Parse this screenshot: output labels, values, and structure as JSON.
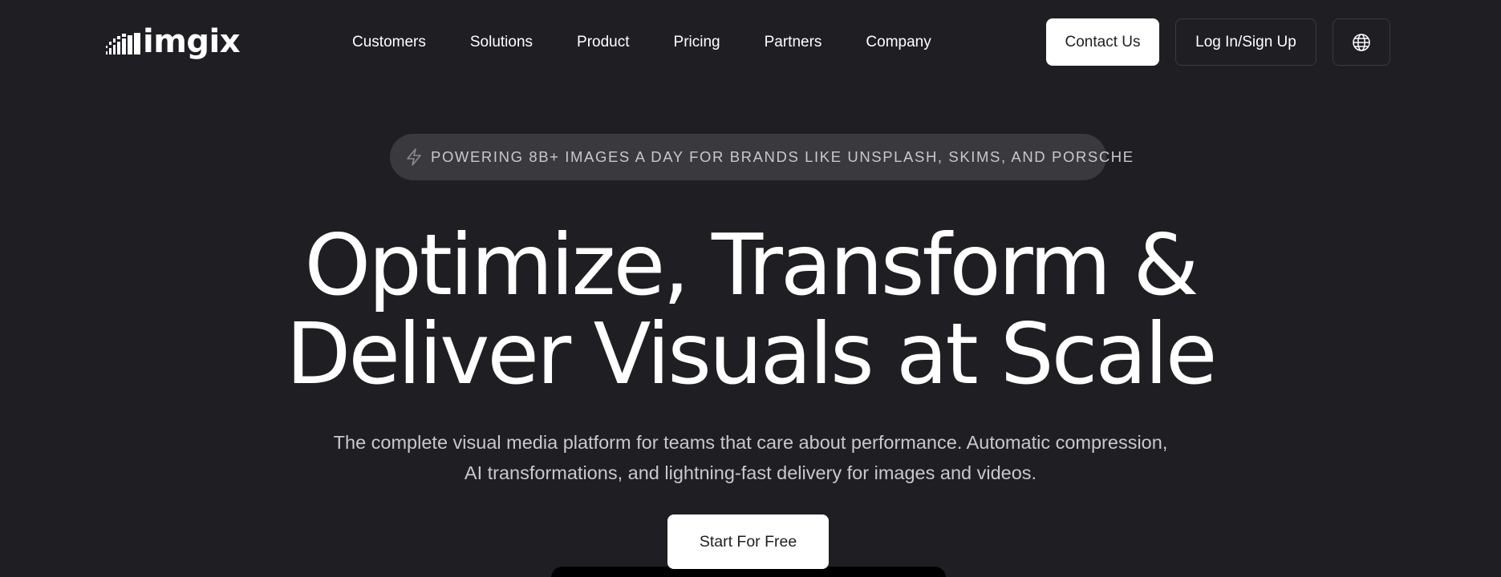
{
  "brand": {
    "name": "imgix"
  },
  "nav": {
    "items": [
      {
        "label": "Customers"
      },
      {
        "label": "Solutions"
      },
      {
        "label": "Product"
      },
      {
        "label": "Pricing"
      },
      {
        "label": "Partners"
      },
      {
        "label": "Company"
      }
    ]
  },
  "header": {
    "contact_label": "Contact Us",
    "login_label": "Log In/Sign Up",
    "language_icon": "globe-icon"
  },
  "hero": {
    "badge_icon": "lightning-icon",
    "badge_text": "POWERING 8B+ IMAGES A DAY FOR BRANDS LIKE UNSPLASH, SKIMS, AND PORSCHE",
    "headline_line1": "Optimize, Transform &",
    "headline_line2": "Deliver Visuals at Scale",
    "subtext_line1": "The complete visual media platform for teams that care about performance. Automatic compression,",
    "subtext_line2": "AI transformations, and lightning-fast delivery for images and videos.",
    "cta_label": "Start For Free"
  },
  "colors": {
    "background": "#1f1e23",
    "badge_background": "#3a393e",
    "muted_text": "#c9c8cc",
    "primary_button": "#ffffff",
    "video_frame": "#000000"
  }
}
